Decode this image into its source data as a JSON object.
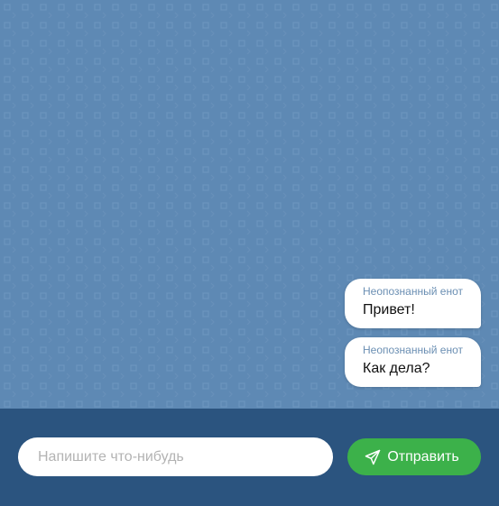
{
  "chat": {
    "background_color": "#5e89b4",
    "messages": [
      {
        "author": "Неопознанный енот",
        "text": "Привет!"
      },
      {
        "author": "Неопознанный енот",
        "text": "Как дела?"
      }
    ]
  },
  "composer": {
    "background_color": "#2b547f",
    "input_placeholder": "Напишите что-нибудь",
    "input_value": "",
    "send_label": "Отправить",
    "send_icon": "paper-plane-icon",
    "send_color": "#3cb14a"
  }
}
